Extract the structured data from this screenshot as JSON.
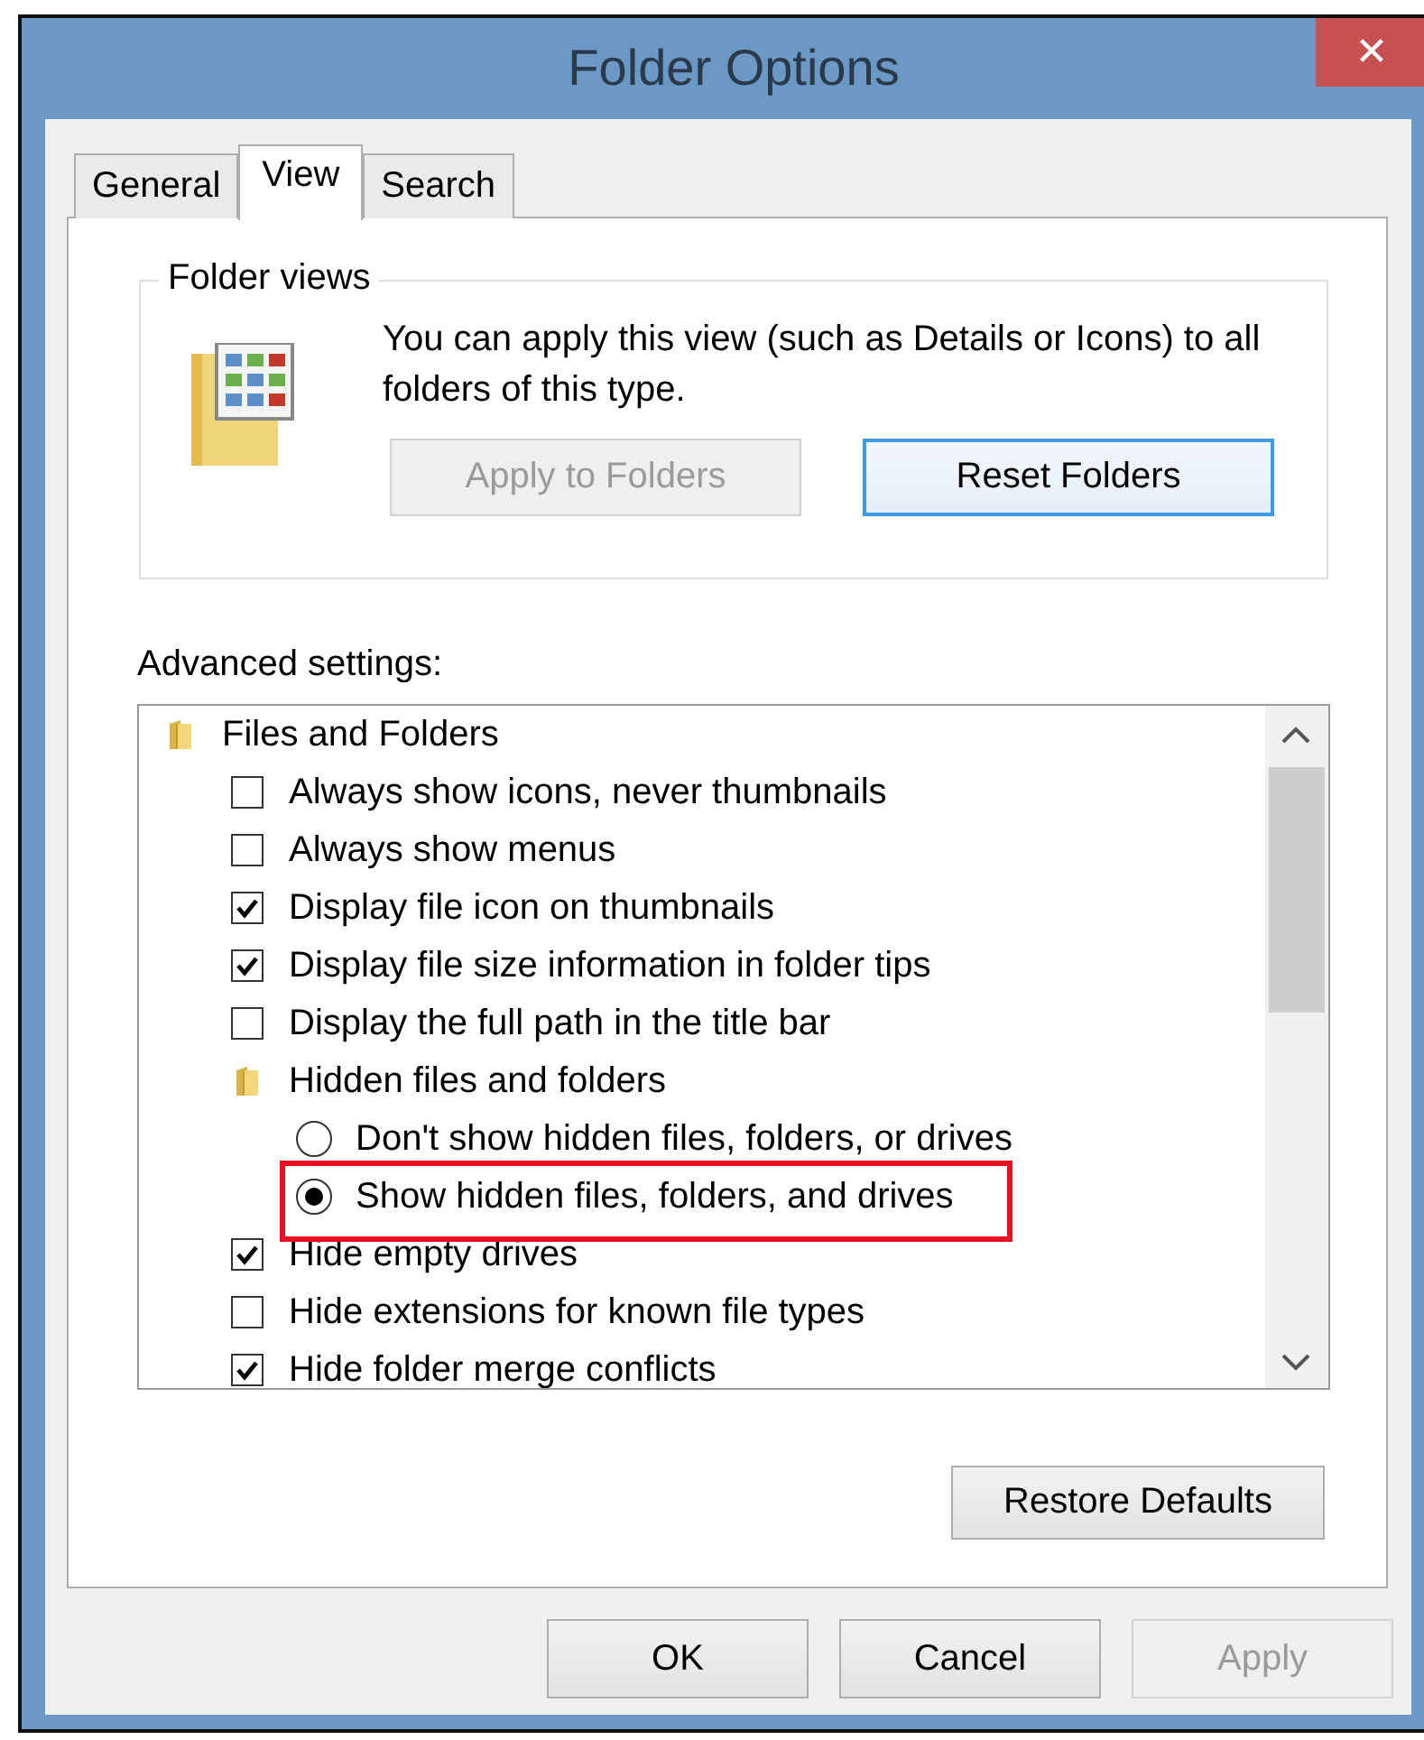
{
  "window": {
    "title": "Folder Options",
    "close": "✕"
  },
  "tabs": [
    {
      "label": "General",
      "selected": false
    },
    {
      "label": "View",
      "selected": true
    },
    {
      "label": "Search",
      "selected": false
    }
  ],
  "folder_views": {
    "legend": "Folder views",
    "text": "You can apply this view (such as Details or Icons) to all folders of this type.",
    "buttons": [
      {
        "label": "Apply to Folders",
        "disabled": true,
        "focused": false
      },
      {
        "label": "Reset Folders",
        "disabled": false,
        "focused": true
      }
    ]
  },
  "advanced_settings": {
    "label": "Advanced settings:",
    "items": [
      {
        "kind": "group",
        "label": "Files and Folders",
        "children": [
          {
            "kind": "checkbox",
            "label": "Always show icons, never thumbnails",
            "checked": false
          },
          {
            "kind": "checkbox",
            "label": "Always show menus",
            "checked": false
          },
          {
            "kind": "checkbox",
            "label": "Display file icon on thumbnails",
            "checked": true
          },
          {
            "kind": "checkbox",
            "label": "Display file size information in folder tips",
            "checked": true
          },
          {
            "kind": "checkbox",
            "label": "Display the full path in the title bar",
            "checked": false
          },
          {
            "kind": "group",
            "label": "Hidden files and folders",
            "children": [
              {
                "kind": "radio",
                "label": "Don't show hidden files, folders, or drives",
                "selected": false,
                "highlighted": false
              },
              {
                "kind": "radio",
                "label": "Show hidden files, folders, and drives",
                "selected": true,
                "highlighted": true
              }
            ]
          },
          {
            "kind": "checkbox",
            "label": "Hide empty drives",
            "checked": true
          },
          {
            "kind": "checkbox",
            "label": "Hide extensions for known file types",
            "checked": false
          },
          {
            "kind": "checkbox",
            "label": "Hide folder merge conflicts",
            "checked": true
          }
        ]
      }
    ],
    "restore_button": "Restore Defaults"
  },
  "buttons": [
    {
      "label": "OK",
      "disabled": false
    },
    {
      "label": "Cancel",
      "disabled": false
    },
    {
      "label": "Apply",
      "disabled": true
    }
  ]
}
